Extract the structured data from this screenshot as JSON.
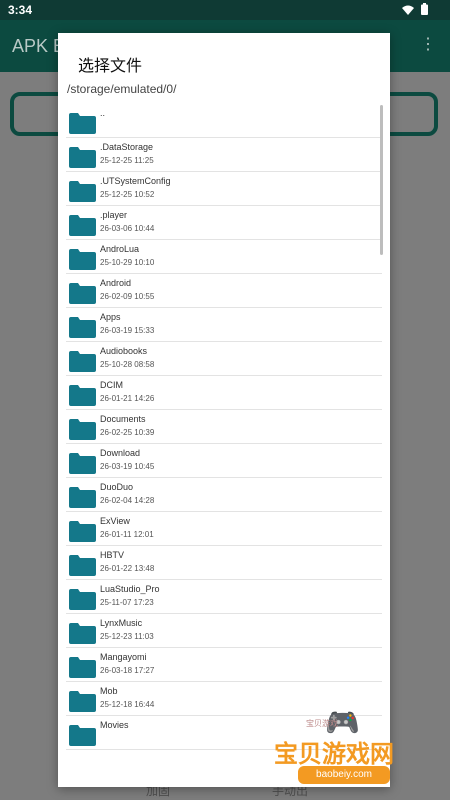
{
  "status_bar": {
    "time": "3:34"
  },
  "app": {
    "title": "APK E",
    "menu_icon": "⋮"
  },
  "bottom_tabs": [
    "加固",
    "手动出"
  ],
  "dialog": {
    "title": "选择文件",
    "path": "/storage/emulated/0/",
    "items": [
      {
        "name": "..",
        "date": ""
      },
      {
        "name": ".DataStorage",
        "date": "25-12-25 11:25"
      },
      {
        "name": ".UTSystemConfig",
        "date": "25-12-25 10:52"
      },
      {
        "name": ".player",
        "date": "26-03-06 10:44"
      },
      {
        "name": "AndroLua",
        "date": "25-10-29 10:10"
      },
      {
        "name": "Android",
        "date": "26-02-09 10:55"
      },
      {
        "name": "Apps",
        "date": "26-03-19 15:33"
      },
      {
        "name": "Audiobooks",
        "date": "25-10-28 08:58"
      },
      {
        "name": "DCIM",
        "date": "26-01-21 14:26"
      },
      {
        "name": "Documents",
        "date": "26-02-25 10:39"
      },
      {
        "name": "Download",
        "date": "26-03-19 10:45"
      },
      {
        "name": "DuoDuo",
        "date": "26-02-04 14:28"
      },
      {
        "name": "ExView",
        "date": "26-01-11 12:01"
      },
      {
        "name": "HBTV",
        "date": "26-01-22 13:48"
      },
      {
        "name": "LuaStudio_Pro",
        "date": "25-11-07 17:23"
      },
      {
        "name": "LynxMusic",
        "date": "25-12-23 11:03"
      },
      {
        "name": "Mangayomi",
        "date": "26-03-18 17:27"
      },
      {
        "name": "Mob",
        "date": "25-12-18 16:44"
      },
      {
        "name": "Movies",
        "date": ""
      }
    ]
  },
  "colors": {
    "folder": "#14788a",
    "app_bar": "#0c4a40",
    "status_bar": "#0f3a34"
  },
  "watermark": {
    "cn": "宝贝游戏网",
    "url": "baobeiy.com",
    "small": "宝贝游戏"
  }
}
